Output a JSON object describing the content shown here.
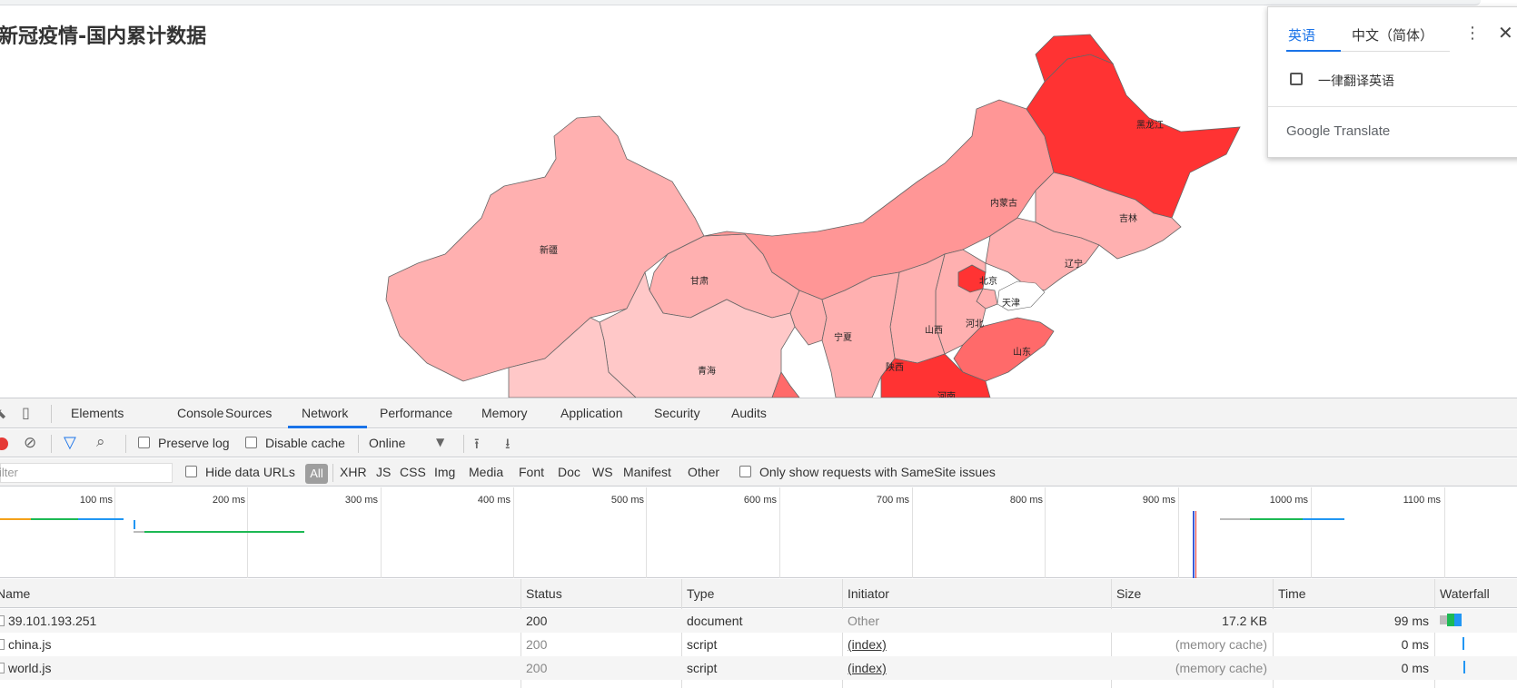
{
  "page": {
    "title": "新冠疫情-国内累计数据",
    "map_labels": [
      "黑龙江",
      "内蒙古",
      "吉林",
      "辽宁",
      "新疆",
      "甘肃",
      "北京",
      "天津",
      "宁夏",
      "山西",
      "河北",
      "青海",
      "陕西",
      "山东",
      "河南"
    ],
    "colors": {
      "severe": "#ff3333",
      "high": "#ff6a6a",
      "medium": "#ff9696",
      "low": "#ffb0b0",
      "lowest": "#ffc8c8"
    }
  },
  "translate_popup": {
    "tab_active": "英语",
    "tab_other": "中文（简体）",
    "checkbox_label": "一律翻译英语",
    "brand": "Google Translate"
  },
  "devtools": {
    "tabs": [
      "Elements",
      "Console",
      "Sources",
      "Network",
      "Performance",
      "Memory",
      "Application",
      "Security",
      "Audits"
    ],
    "active_tab": "Network",
    "toolbar": {
      "preserve_log": "Preserve log",
      "disable_cache": "Disable cache",
      "throttle": "Online"
    },
    "filterbar": {
      "filter_placeholder": "Filter",
      "hide_data_urls": "Hide data URLs",
      "all": "All",
      "types": [
        "XHR",
        "JS",
        "CSS",
        "Img",
        "Media",
        "Font",
        "Doc",
        "WS",
        "Manifest",
        "Other"
      ],
      "samesite": "Only show requests with SameSite issues"
    },
    "overview_ticks": [
      "100 ms",
      "200 ms",
      "300 ms",
      "400 ms",
      "500 ms",
      "600 ms",
      "700 ms",
      "800 ms",
      "900 ms",
      "1000 ms",
      "1100 ms"
    ],
    "columns": [
      "Name",
      "Status",
      "Type",
      "Initiator",
      "Size",
      "Time",
      "Waterfall"
    ],
    "rows": [
      {
        "name": "39.101.193.251",
        "status": "200",
        "type": "document",
        "initiator": "Other",
        "size": "17.2 KB",
        "time": "99 ms"
      },
      {
        "name": "china.js",
        "status": "200",
        "type": "script",
        "initiator": "(index)",
        "size": "(memory cache)",
        "time": "0 ms"
      },
      {
        "name": "world.js",
        "status": "200",
        "type": "script",
        "initiator": "(index)",
        "size": "(memory cache)",
        "time": "0 ms"
      }
    ]
  }
}
